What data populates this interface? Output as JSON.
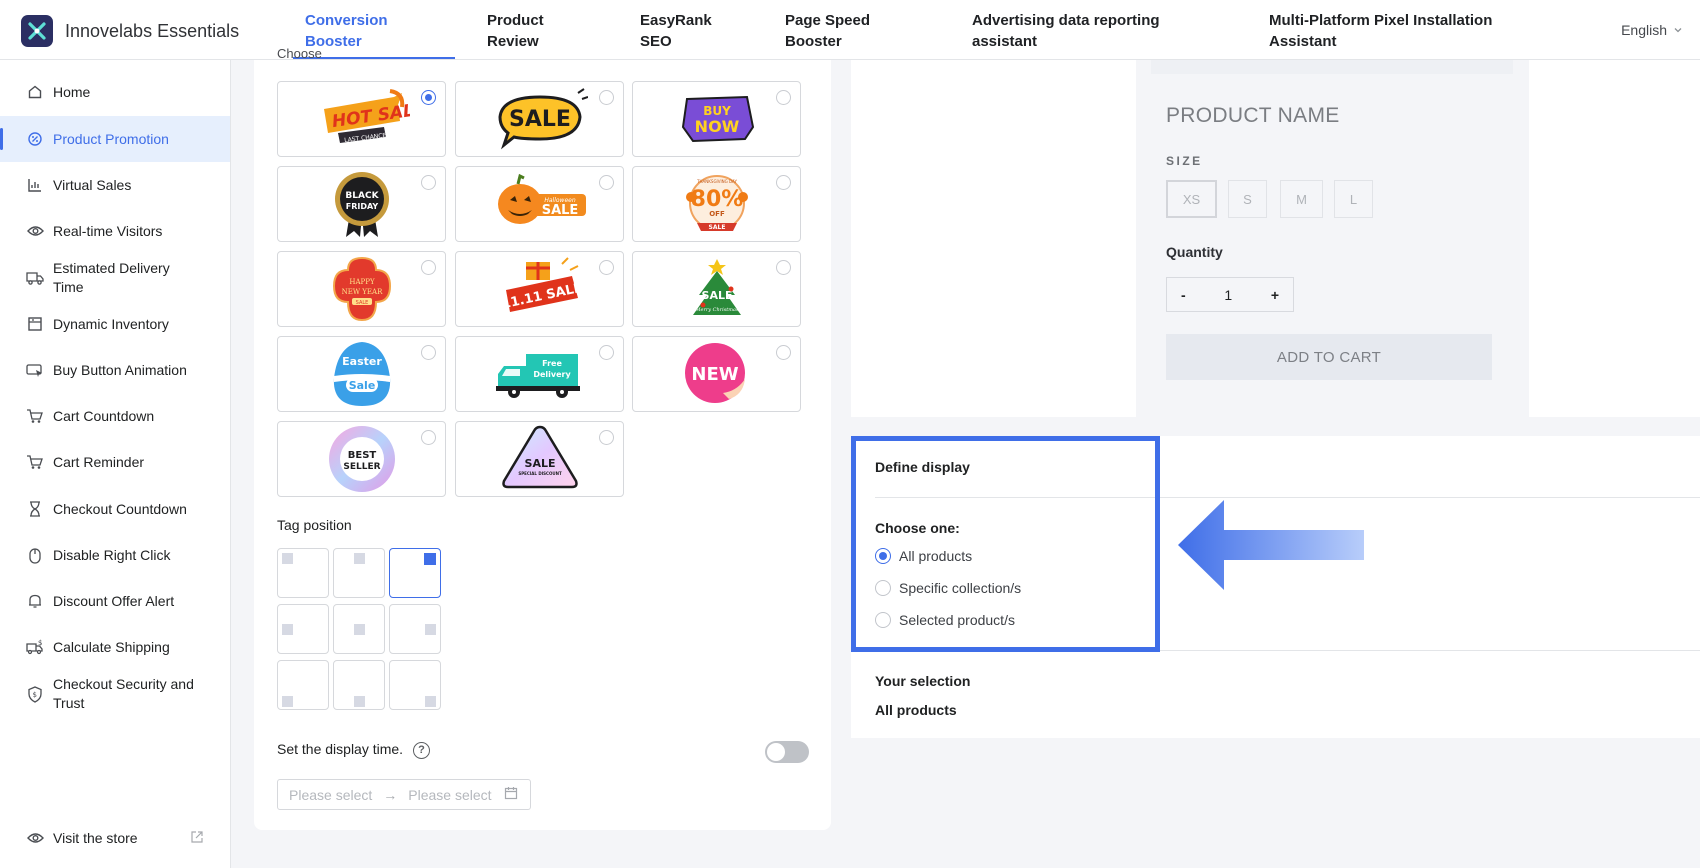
{
  "header": {
    "app_name": "Innovelabs Essentials",
    "tabs": [
      {
        "line1": "Conversion",
        "line2": "Booster",
        "active": true
      },
      {
        "line1": "Product",
        "line2": "Review",
        "active": false
      },
      {
        "line1": "EasyRank",
        "line2": "SEO",
        "active": false
      },
      {
        "line1": "Page Speed",
        "line2": "Booster",
        "active": false
      },
      {
        "line1": "Advertising data reporting",
        "line2": "assistant",
        "active": false
      },
      {
        "line1": "Multi-Platform Pixel Installation",
        "line2": "Assistant",
        "active": false
      }
    ],
    "language": "English"
  },
  "sidebar": {
    "items": [
      {
        "label": "Home",
        "icon": "home-icon"
      },
      {
        "label": "Product Promotion",
        "icon": "promotion-icon",
        "active": true
      },
      {
        "label": "Virtual Sales",
        "icon": "chart-icon"
      },
      {
        "label": "Real-time Visitors",
        "icon": "eye-icon"
      },
      {
        "label": "Estimated Delivery",
        "label2": "Time",
        "icon": "truck-icon"
      },
      {
        "label": "Dynamic Inventory",
        "icon": "inventory-icon"
      },
      {
        "label": "Buy Button Animation",
        "icon": "cursor-icon"
      },
      {
        "label": "Cart Countdown",
        "icon": "cart-icon"
      },
      {
        "label": "Cart Reminder",
        "icon": "cart-icon"
      },
      {
        "label": "Checkout Countdown",
        "icon": "hourglass-icon"
      },
      {
        "label": "Disable Right Click",
        "icon": "mouse-icon"
      },
      {
        "label": "Discount Offer Alert",
        "icon": "bell-icon"
      },
      {
        "label": "Calculate Shipping",
        "icon": "shipping-icon"
      },
      {
        "label": "Checkout Security and",
        "label2": "Trust",
        "icon": "shield-icon"
      }
    ],
    "visit_store": "Visit the store"
  },
  "tags": {
    "choose_label": "Choose",
    "items": [
      {
        "text": "HOT SALE",
        "sub": "LAST CHANCE",
        "selected": true
      },
      {
        "text": "SALE"
      },
      {
        "text": "BUY",
        "sub": "NOW"
      },
      {
        "text": "BLACK",
        "sub": "FRIDAY"
      },
      {
        "text": "SALE",
        "sub": "Halloween"
      },
      {
        "text": "80%",
        "sub": "OFF",
        "extra": "SALE",
        "top": "THANKSGIVING DAY"
      },
      {
        "text": "HAPPY",
        "sub": "NEW YEAR",
        "extra": "SALE"
      },
      {
        "text": "11.11 SALE"
      },
      {
        "text": "SALE",
        "sub": "Merry Christmas"
      },
      {
        "text": "Easter",
        "sub": "Sale"
      },
      {
        "text": "Free",
        "sub": "Delivery"
      },
      {
        "text": "NEW"
      },
      {
        "text": "BEST",
        "sub": "SELLER"
      },
      {
        "text": "SALE",
        "sub": "SPECIAL DISCOUNT"
      }
    ]
  },
  "tag_position": {
    "label": "Tag position",
    "selected_index": 2
  },
  "display_time": {
    "label": "Set the display time.",
    "help": "?",
    "start_placeholder": "Please select",
    "arrow": "→",
    "end_placeholder": "Please select",
    "enabled": false
  },
  "preview": {
    "product_name": "PRODUCT NAME",
    "size_label": "SIZE",
    "sizes": [
      "XS",
      "S",
      "M",
      "L"
    ],
    "quantity_label": "Quantity",
    "minus": "-",
    "quantity": "1",
    "plus": "+",
    "add_to_cart": "ADD TO CART"
  },
  "define_display": {
    "title": "Define display",
    "choose_one": "Choose one:",
    "options": [
      "All products",
      "Specific collection/s",
      "Selected product/s"
    ],
    "selected_option": 0,
    "your_selection_label": "Your selection",
    "your_selection_value": "All products"
  },
  "colors": {
    "accent": "#3f6ee8",
    "highlight_box": "#3f6ee8",
    "sidebar_active_bg": "#e6effd"
  }
}
